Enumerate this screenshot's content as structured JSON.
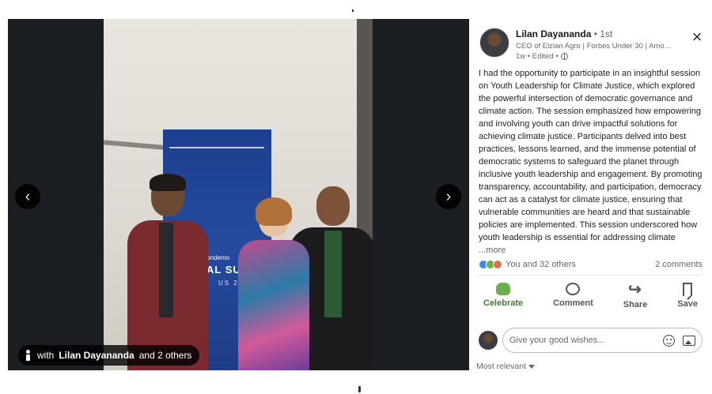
{
  "viewer": {
    "prev_icon": "chevron-left-icon",
    "next_icon": "chevron-right-icon",
    "prev_glyph": "‹",
    "next_glyph": "›",
    "tag": {
      "prefix": "with",
      "name": "Lilan Dayananda",
      "suffix": "and 2 others"
    },
    "banner": {
      "line1": "ondemo",
      "line2": "AL SUM",
      "line3": "US 2"
    }
  },
  "post": {
    "author_name": "Lilan Dayananda",
    "degree": "• 1st",
    "headline": "CEO of Elzian Agro | Forbes Under 30 | Amon...",
    "meta": "1w • Edited •",
    "close_glyph": "×",
    "text": "I had the opportunity to participate in an insightful session on Youth Leadership for Climate Justice, which explored the powerful intersection of democratic governance and climate action. The session emphasized how empowering and involving youth can drive impactful solutions for achieving climate justice. Participants delved into best practices, lessons learned, and the immense potential of democratic systems to safeguard the planet through inclusive youth leadership and engagement. By promoting transparency, accountability, and participation, democracy can act as a catalyst for climate justice, ensuring that vulnerable communities are heard and that sustainable policies are implemented. This session underscored how youth leadership is essential for addressing climate",
    "more": "...more"
  },
  "social": {
    "reactions_text": "You and 32 others",
    "comments_text": "2 comments"
  },
  "actions": {
    "celebrate": "Celebrate",
    "comment": "Comment",
    "share": "Share",
    "save": "Save"
  },
  "comment_box": {
    "placeholder": "Give your good wishes..."
  },
  "sort": {
    "label": "Most relevant"
  },
  "colors": {
    "viewer_bg": "#1b1f23",
    "celebrate_active": "#437a33",
    "like": "#378fe9",
    "celebrate": "#6dae4f",
    "love": "#df704d"
  }
}
